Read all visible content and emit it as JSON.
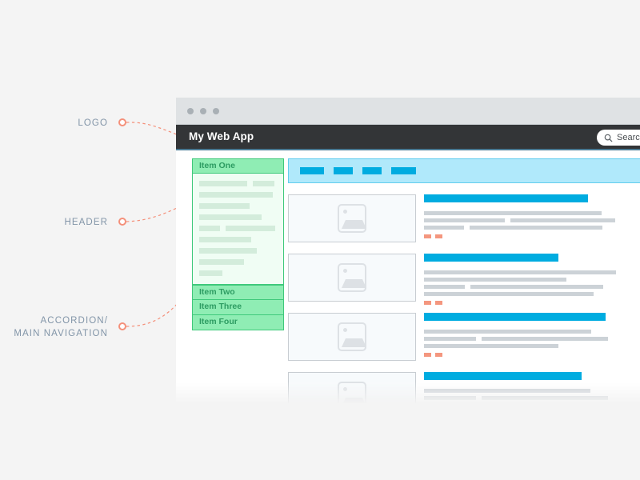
{
  "annotations": [
    {
      "id": "logo",
      "label": "LOGO"
    },
    {
      "id": "header",
      "label": "HEADER"
    },
    {
      "id": "nav",
      "label": "ACCORDION/\nMAIN NAVIGATION"
    }
  ],
  "colors": {
    "page_background": "#f4f4f4",
    "annotation": "#f4907a",
    "annotation_text": "#8295a8",
    "header_bar": "#333537",
    "accent_blue": "#00ace0",
    "nav_background": "#b0e9fb",
    "accordion_header": "#8fedb4",
    "accordion_border": "#3fc97b",
    "accordion_text": "#2d9c62",
    "tag_orange": "#f4977f",
    "text_placeholder": "#ccd2d7"
  },
  "window": {
    "chrome": {
      "dots": 3
    },
    "header": {
      "app_title": "My Web App",
      "search": {
        "label": "Search",
        "icon": "search-icon"
      }
    }
  },
  "accordion": {
    "items": [
      {
        "label": "Item One",
        "expanded": true
      },
      {
        "label": "Item Two",
        "expanded": false
      },
      {
        "label": "Item Three",
        "expanded": false
      },
      {
        "label": "Item Four",
        "expanded": false
      }
    ],
    "panel_rows": [
      [
        60,
        27
      ],
      [
        92
      ],
      [
        63
      ],
      [
        78
      ],
      [
        26,
        62
      ],
      [
        65
      ],
      [
        72
      ],
      [
        56
      ],
      [
        29
      ]
    ]
  },
  "main": {
    "navbar": {
      "item_widths": [
        30,
        24,
        24,
        31
      ]
    },
    "cards": [
      {
        "thumbnail": "image-placeholder",
        "title_width": 205,
        "text_rows": [
          [
            222
          ],
          [
            101,
            131
          ],
          [
            50,
            166
          ]
        ],
        "tags": 2
      },
      {
        "thumbnail": "image-placeholder",
        "title_width": 168,
        "text_rows": [
          [
            240
          ],
          [
            178
          ],
          [
            51,
            166
          ],
          [
            212
          ]
        ],
        "tags": 2
      },
      {
        "thumbnail": "image-placeholder",
        "title_width": 227,
        "text_rows": [
          [
            209
          ],
          [
            65,
            158
          ],
          [
            168
          ]
        ],
        "tags": 2
      },
      {
        "thumbnail": "image-placeholder",
        "title_width": 197,
        "text_rows": [
          [
            208
          ],
          [
            65,
            158
          ],
          [
            168
          ]
        ],
        "tags": 2
      }
    ]
  }
}
